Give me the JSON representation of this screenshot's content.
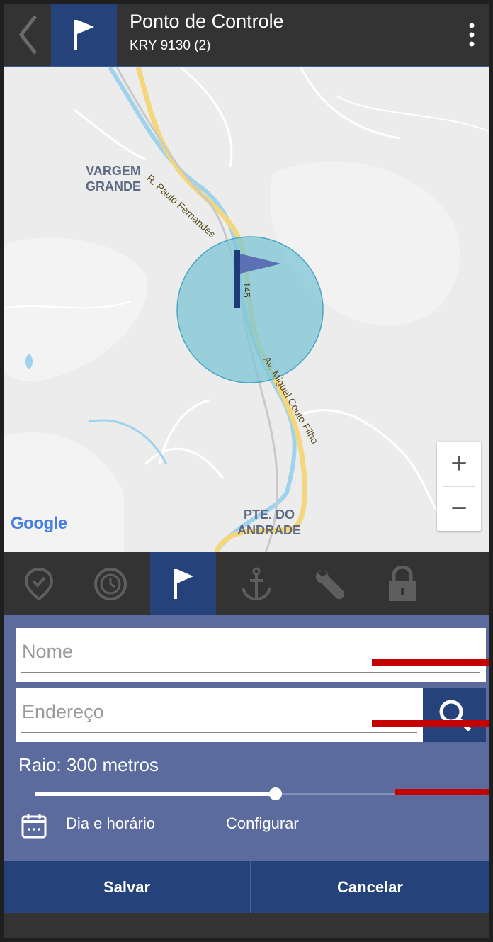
{
  "header": {
    "title": "Ponto de Controle",
    "subtitle": "KRY 9130 (2)",
    "back_icon": "chevron-left-icon",
    "flag_icon": "flag-icon",
    "menu_icon": "more-vert-icon"
  },
  "map": {
    "labels": {
      "vargem": "VARGEM\nGRANDE",
      "pte": "PTE. DO\nANDRADE",
      "street1": "R. Paulo Fernandes",
      "street2": "Av. Miguel Couto Filho",
      "route": "145"
    },
    "attribution": "Google",
    "zoom_in": "+",
    "zoom_out": "−",
    "circle_color": "#7cc6d6"
  },
  "tabs": [
    {
      "name": "location-pin-icon",
      "active": false
    },
    {
      "name": "history-icon",
      "active": false
    },
    {
      "name": "flag-icon",
      "active": true
    },
    {
      "name": "anchor-icon",
      "active": false
    },
    {
      "name": "wrench-icon",
      "active": false
    },
    {
      "name": "lock-icon",
      "active": false
    }
  ],
  "form": {
    "nome_placeholder": "Nome",
    "endereco_placeholder": "Endereço",
    "raio_label": "Raio: 300 metros",
    "radius_slider_fraction": 0.54,
    "schedule_label": "Dia e horário",
    "config_label": "Configurar"
  },
  "footer": {
    "save_label": "Salvar",
    "cancel_label": "Cancelar"
  },
  "colors": {
    "header_bg": "#333333",
    "accent": "#25427a",
    "panel_bg": "#5b6b9d",
    "annotation_red": "#c40000"
  }
}
